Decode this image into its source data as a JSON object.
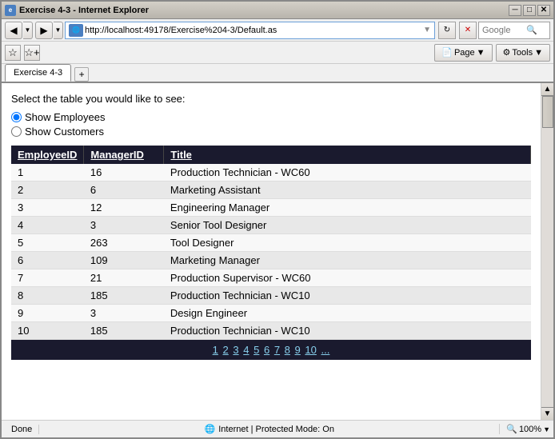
{
  "window": {
    "title": "Exercise 4-3 - Internet Explorer",
    "icon": "IE"
  },
  "nav": {
    "address": "http://localhost:49178/Exercise%204-3/Default.as",
    "search_placeholder": "Google"
  },
  "tabs": [
    {
      "label": "Exercise 4-3",
      "active": true
    }
  ],
  "toolbar2": {
    "page_label": "Page",
    "tools_label": "Tools"
  },
  "content": {
    "instruction": "Select the table you would like to see:",
    "radio_employees": "Show Employees",
    "radio_customers": "Show Customers",
    "employees_selected": true
  },
  "table": {
    "headers": [
      "EmployeeID",
      "ManagerID",
      "Title"
    ],
    "rows": [
      {
        "id": "1",
        "manager": "16",
        "title": "Production Technician - WC60"
      },
      {
        "id": "2",
        "manager": "6",
        "title": "Marketing Assistant"
      },
      {
        "id": "3",
        "manager": "12",
        "title": "Engineering Manager"
      },
      {
        "id": "4",
        "manager": "3",
        "title": "Senior Tool Designer"
      },
      {
        "id": "5",
        "manager": "263",
        "title": "Tool Designer"
      },
      {
        "id": "6",
        "manager": "109",
        "title": "Marketing Manager"
      },
      {
        "id": "7",
        "manager": "21",
        "title": "Production Supervisor - WC60"
      },
      {
        "id": "8",
        "manager": "185",
        "title": "Production Technician - WC10"
      },
      {
        "id": "9",
        "manager": "3",
        "title": "Design Engineer"
      },
      {
        "id": "10",
        "manager": "185",
        "title": "Production Technician - WC10"
      }
    ],
    "pagination": {
      "pages": [
        "1",
        "2",
        "3",
        "4",
        "5",
        "6",
        "7",
        "8",
        "9",
        "10"
      ],
      "ellipsis": "..."
    }
  },
  "status": {
    "done": "Done",
    "security": "Internet | Protected Mode: On",
    "zoom": "100%"
  },
  "colors": {
    "table_header_bg": "#1a1a2e",
    "pagination_bg": "#1a1a2e"
  }
}
